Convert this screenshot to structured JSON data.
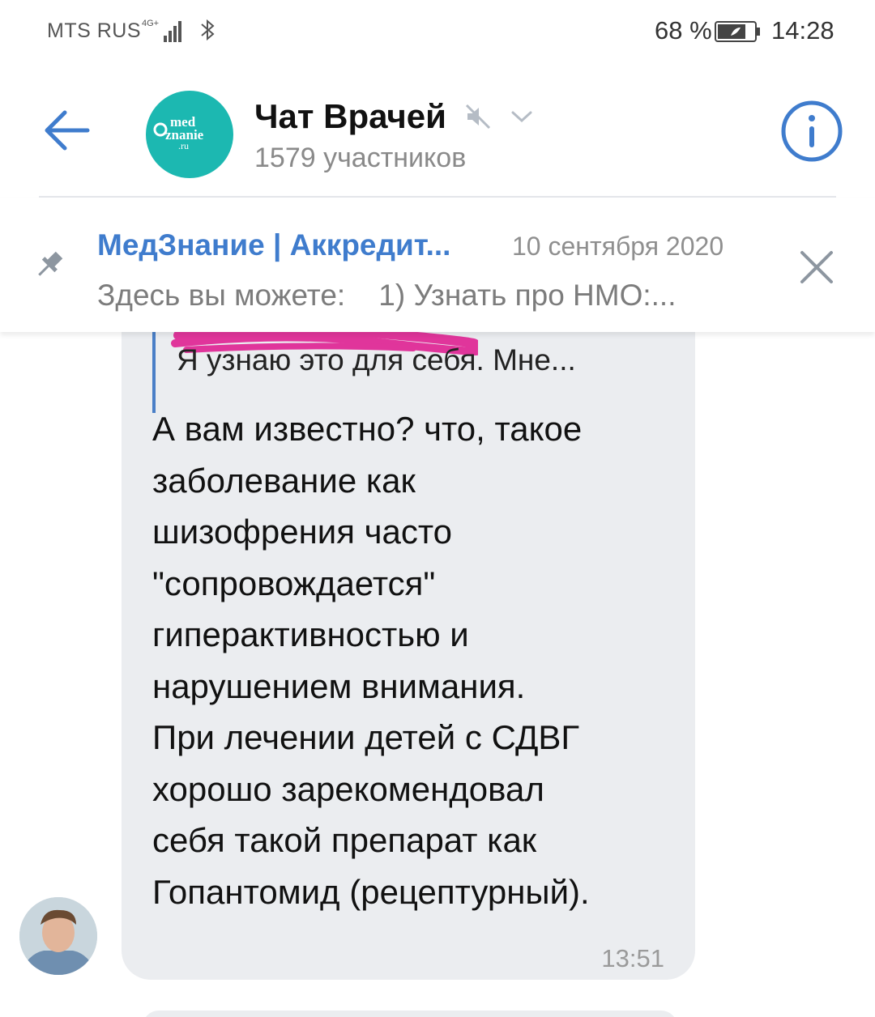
{
  "status_bar": {
    "carrier": "MTS RUS",
    "network": "4G+",
    "battery_percent": "68 %",
    "time": "14:28"
  },
  "header": {
    "title": "Чат Врачей",
    "subtitle": "1579 участников",
    "avatar_lines": [
      "med",
      "znanie",
      ".ru"
    ],
    "icons": [
      "arrow-left-icon",
      "mute-icon",
      "chevron-down-icon",
      "info-icon"
    ]
  },
  "pinned": {
    "author": "МедЗнание | Аккредит...",
    "date": "10 сентября 2020",
    "text": "Здесь вы можете:    1) Узнать про НМО:..."
  },
  "message": {
    "reply_author": "",
    "reply_text": "Я узнаю это для себя. Мне...",
    "lines": [
      "А вам известно? что, такое",
      "заболевание как",
      "шизофрения часто",
      "\"сопровождается\"",
      "гиперактивностью и",
      "нарушением внимания.",
      "При лечении детей с СДВГ",
      "хорошо зарекомендовал",
      "себя такой препарат как",
      "Гопантомид (рецептурный)."
    ],
    "time": "13:51"
  },
  "colors": {
    "accent": "#3f7ccd",
    "bubble": "#ebedf0",
    "avatar_teal": "#1cb8b1",
    "redaction": "#e0359b"
  }
}
